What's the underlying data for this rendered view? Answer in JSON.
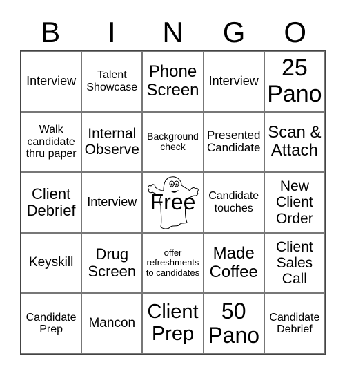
{
  "header": {
    "letters": [
      "B",
      "I",
      "N",
      "G",
      "O"
    ]
  },
  "cells": [
    {
      "text": "Interview"
    },
    {
      "text": "Talent\nShowcase"
    },
    {
      "text": "Phone\nScreen"
    },
    {
      "text": "Interview"
    },
    {
      "text": "25\nPano"
    },
    {
      "text": "Walk\ncandidate\nthru paper"
    },
    {
      "text": "Internal\nObserve"
    },
    {
      "text": "Background\ncheck"
    },
    {
      "text": "Presented\nCandidate"
    },
    {
      "text": "Scan &\nAttach"
    },
    {
      "text": "Client\nDebrief"
    },
    {
      "text": "Interview"
    },
    {
      "text": "Free",
      "icon": "ghost-icon"
    },
    {
      "text": "Candidate\ntouches"
    },
    {
      "text": "New\nClient\nOrder"
    },
    {
      "text": "Keyskill"
    },
    {
      "text": "Drug\nScreen"
    },
    {
      "text": "offer\nrefreshments\nto candidates"
    },
    {
      "text": "Made\nCoffee"
    },
    {
      "text": "Client\nSales\nCall"
    },
    {
      "text": "Candidate\nPrep"
    },
    {
      "text": "Mancon"
    },
    {
      "text": "Client\nPrep"
    },
    {
      "text": "50\nPano"
    },
    {
      "text": "Candidate\nDebrief"
    }
  ]
}
